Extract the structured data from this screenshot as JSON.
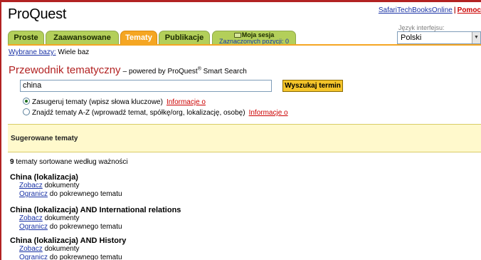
{
  "logo": "ProQuest",
  "toplinks": {
    "safari": "SafariTechBooksOnline",
    "separator": "|",
    "help": "Pomoc"
  },
  "language": {
    "label": "Język interfejsu:",
    "value": "Polski"
  },
  "tabs": [
    {
      "label": "Proste",
      "active": false
    },
    {
      "label": "Zaawansowane",
      "active": false
    },
    {
      "label": "Tematy",
      "active": true
    },
    {
      "label": "Publikacje",
      "active": false
    }
  ],
  "session_tab": {
    "label": "Moja sesja",
    "sublabel": "Zaznaczonych pozycji: 0"
  },
  "selected_db": {
    "link": "Wybrane bazy:",
    "value": "Wiele baz"
  },
  "title": {
    "main": "Przewodnik tematyczny",
    "prefix": "– powered by ProQuest",
    "reg": "®",
    "suffix": " Smart Search"
  },
  "search": {
    "value": "china",
    "button": "Wyszukaj termin"
  },
  "options": [
    {
      "label": "Zasugeruj tematy (wpisz słowa kluczowe)",
      "info": "Informacje o",
      "selected": true
    },
    {
      "label": "Znajdź tematy A-Z (wprowadź temat, spółkę/org, lokalizację, osobę)",
      "info": "Informacje o",
      "selected": false
    }
  ],
  "suggested_label": "Sugerowane tematy",
  "results": {
    "count": "9",
    "count_text": " tematy sortowane według ważności"
  },
  "topics": [
    {
      "title": "China (lokalizacja)",
      "view": "Zobacz",
      "view_text": " dokumenty",
      "narrow": "Ogranicz",
      "narrow_text": " do pokrewnego tematu"
    },
    {
      "title": "China (lokalizacja) AND International relations",
      "view": "Zobacz",
      "view_text": " dokumenty",
      "narrow": "Ogranicz",
      "narrow_text": " do pokrewnego tematu"
    },
    {
      "title": "China (lokalizacja) AND History",
      "view": "Zobacz",
      "view_text": " dokumenty",
      "narrow": "Ogranicz",
      "narrow_text": " do pokrewnego tematu"
    }
  ],
  "colors": {
    "brand_red": "#b22222",
    "tab_green": "#b3cf5a",
    "tab_active": "#f5a623",
    "suggest_bg": "#fff9cc"
  }
}
